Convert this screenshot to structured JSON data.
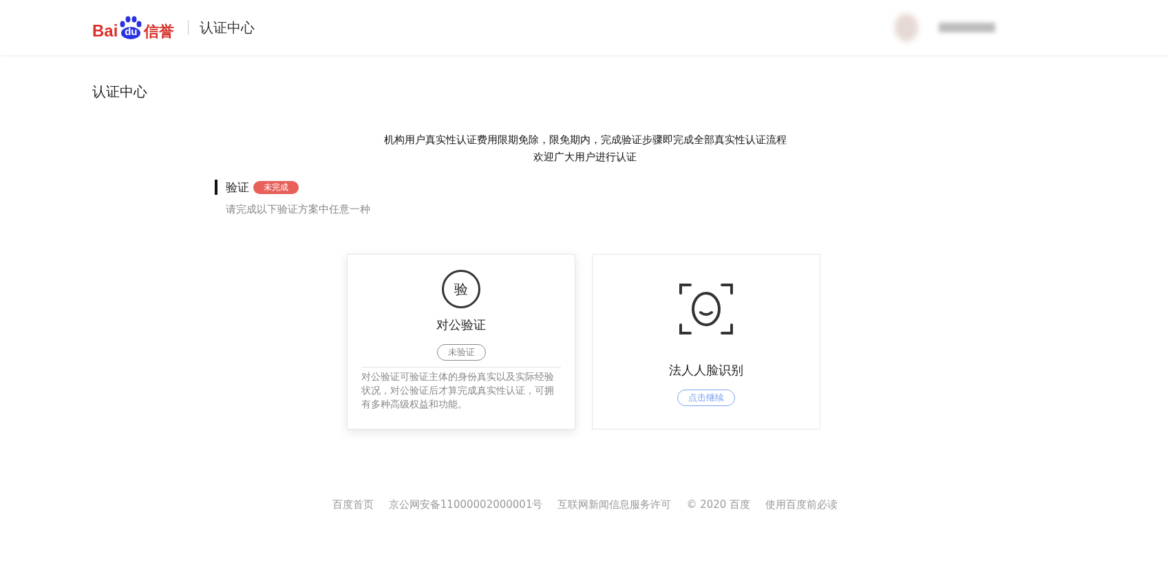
{
  "header": {
    "logo": {
      "part_1": "Bai",
      "part_2": "du",
      "part_3": "信誉"
    },
    "title": "认证中心"
  },
  "page_title": "认证中心",
  "notice": [
    "机构用户真实性认证费用限期免除，限免期内，完成验证步骤即完成全部真实性认证流程",
    "欢迎广大用户进行认证"
  ],
  "section": {
    "title": "验证",
    "status": "未完成",
    "subtitle": "请完成以下验证方案中任意一种"
  },
  "cards": [
    {
      "kind": "seal",
      "icon_text": "验",
      "title": "对公验证",
      "badge": {
        "kind": "status",
        "label": "未验证"
      },
      "description": "对公验证可验证主体的身份真实以及实际经验状况，对公验证后才算完成真实性认证，可拥有多种高级权益和功能。",
      "highlighted": true
    },
    {
      "kind": "face",
      "title": "法人人脸识别",
      "badge": {
        "kind": "action",
        "label": "点击继续"
      },
      "highlighted": false
    }
  ],
  "footer": [
    "百度首页",
    "京公网安备11000002000001号",
    "互联网新闻信息服务许可",
    "© 2020 百度",
    "使用百度前必读"
  ]
}
